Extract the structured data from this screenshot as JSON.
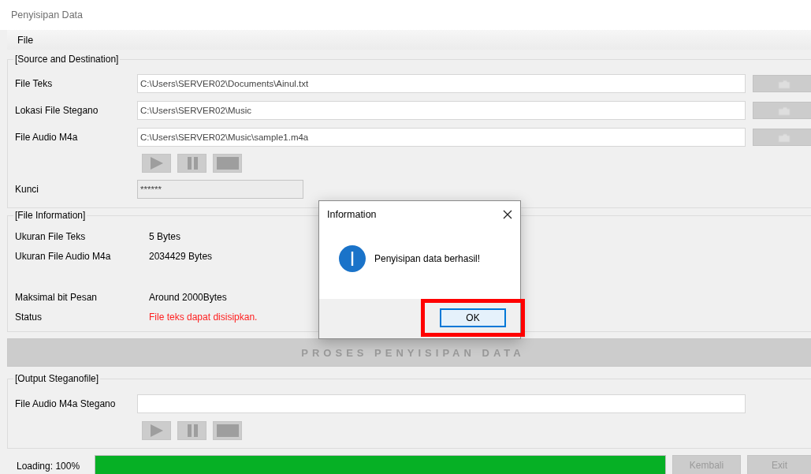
{
  "window": {
    "title": "Penyisipan Data"
  },
  "menu": [
    {
      "label": "File"
    }
  ],
  "source_group": {
    "title": "[Source and Destination]",
    "fields": [
      {
        "label": "File Teks",
        "value": "C:\\Users\\SERVER02\\Documents\\Ainul.txt"
      },
      {
        "label": "Lokasi File Stegano",
        "value": "C:\\Users\\SERVER02\\Music"
      },
      {
        "label": "File Audio M4a",
        "value": "C:\\Users\\SERVER02\\Music\\sample1.m4a"
      }
    ],
    "key": {
      "label": "Kunci",
      "value": "******",
      "disabled": true
    }
  },
  "file_information": {
    "title": "[File Information]",
    "rows": [
      {
        "label": "Ukuran File Teks",
        "value": "5 Bytes",
        "kind": "normal"
      },
      {
        "label": "Ukuran File Audio M4a",
        "value": "2034429 Bytes",
        "kind": "normal"
      },
      {
        "label": "Maksimal bit Pesan",
        "value": "Around 2000Bytes",
        "kind": "normal"
      },
      {
        "label": "Status",
        "value": "File teks dapat disisipkan.",
        "kind": "alert"
      }
    ]
  },
  "process_button": {
    "label": "PROSES PENYISIPAN DATA",
    "disabled": true
  },
  "output_group": {
    "title": "[Output Steganofile]",
    "field": {
      "label": "File Audio M4a Stegano"
    }
  },
  "loading": {
    "label": "Loading: 100%",
    "level": 1
  },
  "buttons": [
    {
      "label": "Kembali",
      "disabled": true
    },
    {
      "label": "Exit",
      "disabled": true
    }
  ],
  "dialog": {
    "title": "Information",
    "message": "Penyisipan data berhasil!",
    "button": {
      "label": "OK",
      "highlighted": true
    }
  }
}
